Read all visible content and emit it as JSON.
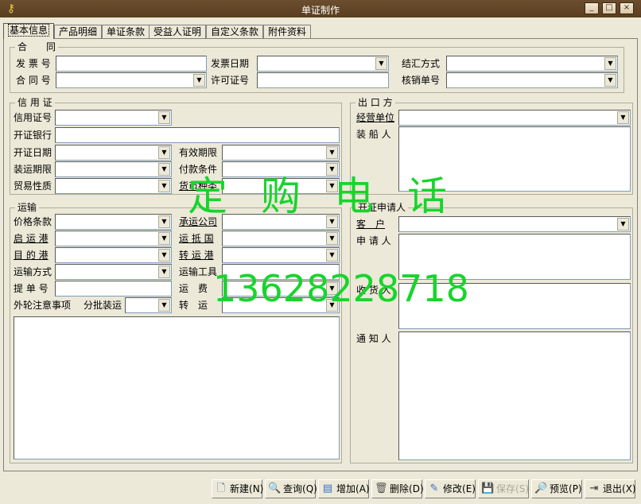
{
  "window": {
    "title": "单证制作",
    "app_icon": "key-icon",
    "controls": [
      "_",
      "□",
      "×"
    ]
  },
  "tabs": [
    "基本信息",
    "产品明细",
    "单证条款",
    "受益人证明",
    "自定义条款",
    "附件资料"
  ],
  "contract": {
    "legend": "合　　同",
    "invoice_no": "发 票 号",
    "invoice_date": "发票日期",
    "settlement": "结汇方式",
    "contract_no": "合 同 号",
    "license_no": "许可证号",
    "verification_no": "核销单号"
  },
  "lc": {
    "legend": "信 用 证",
    "lc_no": "信用证号",
    "issuing_bank": "开证银行",
    "issue_date": "开证日期",
    "valid_date": "有效期限",
    "ship_date": "装运期限",
    "payment": "付款条件",
    "trade_nature": "贸易性质",
    "currency": "货币种类"
  },
  "exporter": {
    "legend": "出 口 方",
    "operating_unit": "经营单位",
    "shipper": "装 船 人"
  },
  "transport": {
    "legend": "运输",
    "price_terms": "价格条款",
    "carrier": "承运公司",
    "departure_port": "启 运 港",
    "arrival_port": "运 抵 国",
    "dest_port": "目 的 港",
    "transit_port": "转 运 港",
    "mode": "运输方式",
    "vehicle": "运输工具",
    "bl_no": "提 单 号",
    "freight": "运　费",
    "notes": "外轮注意事项",
    "partial": "分批装运",
    "transship": "转　运"
  },
  "applicant": {
    "legend": "开证申请人",
    "customer": "客　户",
    "applicant": "申 请 人",
    "consignee": "收 货 人",
    "notify": "通 知 人"
  },
  "watermark": {
    "line1": "定购电话",
    "line2": "13628228718"
  },
  "toolbar": [
    {
      "label": "新建",
      "key": "(N)",
      "icon": "new-doc-icon",
      "enabled": true
    },
    {
      "label": "查询",
      "key": "(Q)",
      "icon": "search-icon",
      "enabled": true
    },
    {
      "label": "增加",
      "key": "(A)",
      "icon": "add-icon",
      "enabled": true
    },
    {
      "label": "删除",
      "key": "(D)",
      "icon": "trash-icon",
      "enabled": true
    },
    {
      "label": "修改",
      "key": "(E)",
      "icon": "edit-icon",
      "enabled": true
    },
    {
      "label": "保存",
      "key": "(S)",
      "icon": "save-icon",
      "enabled": false
    },
    {
      "label": "预览",
      "key": "(P)",
      "icon": "preview-icon",
      "enabled": true
    },
    {
      "label": "退出",
      "key": "(X)",
      "icon": "exit-icon",
      "enabled": true
    }
  ]
}
